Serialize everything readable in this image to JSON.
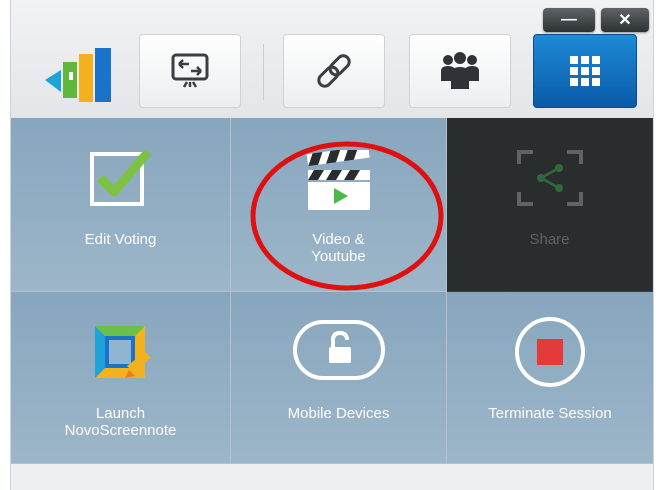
{
  "window": {
    "minimize_glyph": "—",
    "close_glyph": "✕"
  },
  "toolbar": {
    "icons": [
      "logo-icon",
      "screen-share-icon",
      "link-icon",
      "users-group-icon",
      "grid-menu-icon"
    ],
    "active_button": "grid-menu",
    "active_color": "#1570c0"
  },
  "tiles": [
    {
      "label": "Edit Voting",
      "icon": "checkbox-icon",
      "enabled": true
    },
    {
      "label": "Video &",
      "label2": "Youtube",
      "icon": "clapperboard-icon",
      "enabled": true
    },
    {
      "label": "Share",
      "icon": "share-icon",
      "enabled": false
    },
    {
      "label": "Launch",
      "label2": "NovoScreennote",
      "icon": "screennote-icon",
      "enabled": true
    },
    {
      "label": "Mobile Devices",
      "icon": "unlock-icon",
      "enabled": true
    },
    {
      "label": "Terminate Session",
      "icon": "stop-icon",
      "enabled": true
    }
  ],
  "colors": {
    "tile_bg": "#93aec3",
    "tile_disabled_bg": "#2a2d2e",
    "annotation_circle": "#e01010",
    "check_green": "#7dc242",
    "stop_red": "#e43a3a"
  }
}
